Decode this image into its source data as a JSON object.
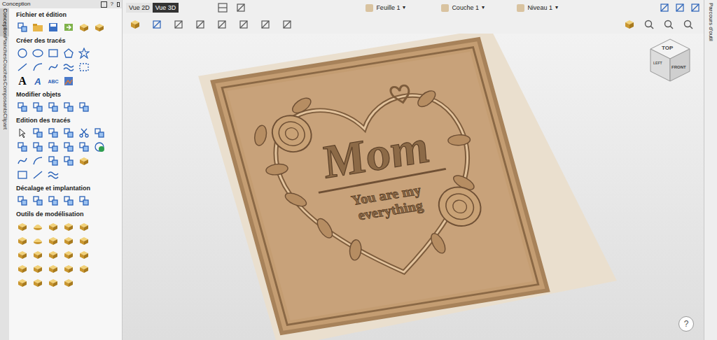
{
  "panel": {
    "title": "Conception",
    "help": "?"
  },
  "side_tabs": [
    {
      "label": "Conception",
      "selected": true
    },
    {
      "label": "Planches",
      "selected": false
    },
    {
      "label": "Couches",
      "selected": false
    },
    {
      "label": "Composants",
      "selected": false
    },
    {
      "label": "Clipart",
      "selected": false
    }
  ],
  "sections": [
    {
      "title": "Fichier et édition",
      "glyph_icons": []
    },
    {
      "title": "Créer des tracés",
      "glyph_icons": [
        "A",
        "A",
        "ABC"
      ]
    },
    {
      "title": "Modifier objets",
      "glyph_icons": []
    },
    {
      "title": "Edition des tracés",
      "glyph_icons": []
    },
    {
      "title": "Décalage et implantation",
      "glyph_icons": []
    },
    {
      "title": "Outils de modélisation",
      "glyph_icons": []
    }
  ],
  "view_tabs": [
    {
      "label": "Vue 2D",
      "selected": false
    },
    {
      "label": "Vue 3D",
      "selected": true
    }
  ],
  "dropdowns": [
    {
      "label": "Feuille 1",
      "arrow": "▾"
    },
    {
      "label": "Couche 1",
      "arrow": "▾"
    },
    {
      "label": "Niveau 1",
      "arrow": "▾"
    }
  ],
  "right_tab": {
    "label": "Parcours d'outil"
  },
  "view_cube": {
    "top": "TOP",
    "front": "FRONT",
    "left": "LEFT"
  },
  "relief": {
    "title": "Mom",
    "subtitle_lines": [
      "You are my",
      "everything"
    ]
  },
  "help_button": "?"
}
